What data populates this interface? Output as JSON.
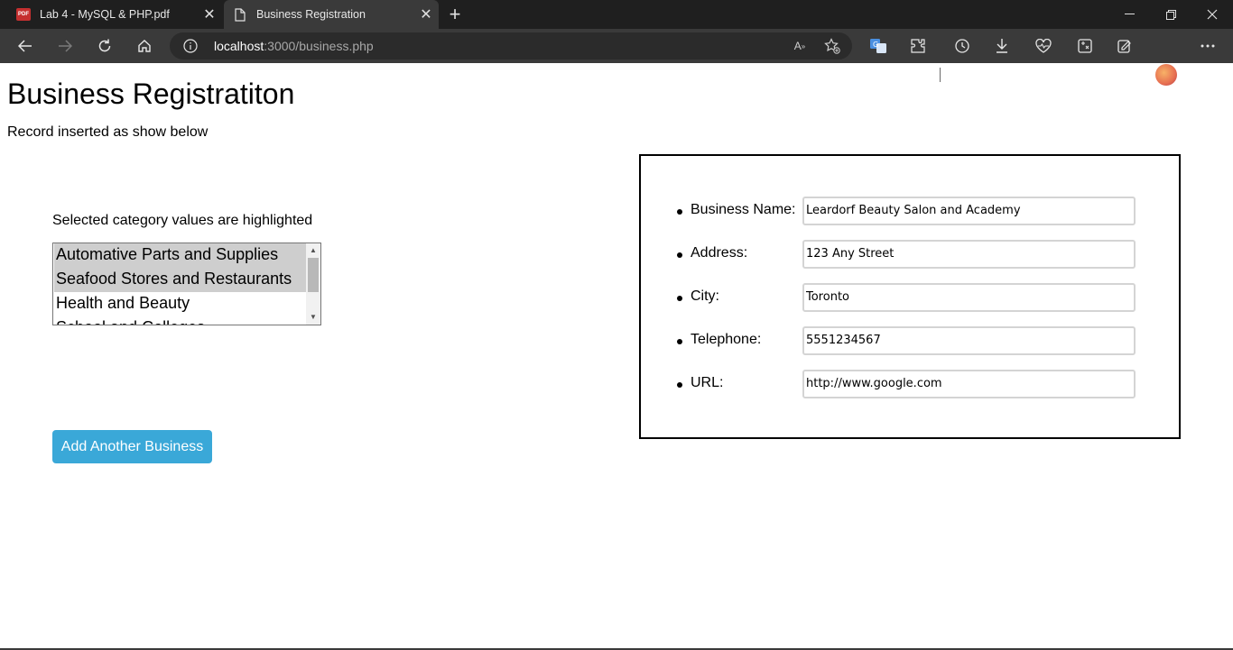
{
  "browser": {
    "tabs": [
      {
        "title": "Lab 4 - MySQL & PHP.pdf",
        "icon": "pdf-icon",
        "active": false
      },
      {
        "title": "Business Registration",
        "icon": "page-icon",
        "active": true
      }
    ],
    "url_host": "localhost",
    "url_path": ":3000/business.php"
  },
  "page": {
    "heading": "Business Registratiton",
    "status": "Record inserted as show below",
    "category_hint": "Selected category values are highlighted",
    "categories": [
      {
        "label": "Automative Parts and Supplies",
        "selected": true
      },
      {
        "label": "Seafood Stores and Restaurants",
        "selected": true
      },
      {
        "label": "Health and Beauty",
        "selected": false
      },
      {
        "label": "School and Colleges",
        "selected": false
      }
    ],
    "add_button": "Add Another Business",
    "fields": [
      {
        "label": "Business Name:",
        "value": "Leardorf Beauty Salon and Academy"
      },
      {
        "label": "Address:",
        "value": "123 Any Street"
      },
      {
        "label": "City:",
        "value": "Toronto"
      },
      {
        "label": "Telephone:",
        "value": "5551234567"
      },
      {
        "label": "URL:",
        "value": "http://www.google.com"
      }
    ]
  },
  "colors": {
    "button": "#3aa8d8",
    "selected_option": "#cecece",
    "chrome_dark": "#1f1f1f",
    "chrome_toolbar": "#3a3a3a"
  }
}
